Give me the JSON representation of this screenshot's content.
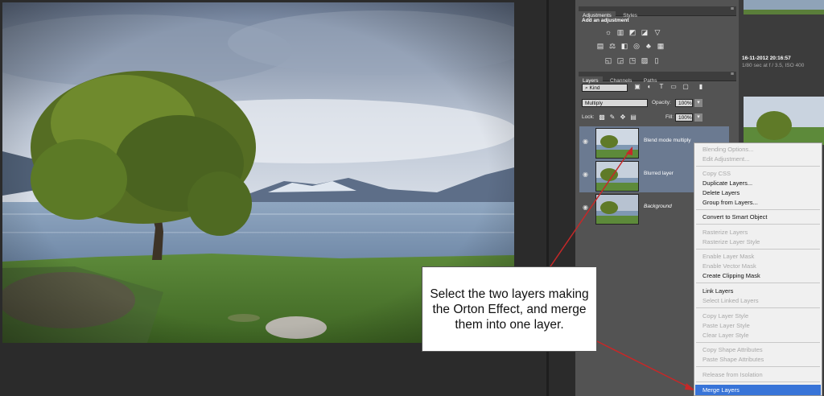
{
  "adjustments": {
    "tabs": [
      "Adjustments",
      "Styles"
    ],
    "heading": "Add an adjustment"
  },
  "layers_panel": {
    "tabs": [
      "Layers",
      "Channels",
      "Paths"
    ],
    "filter_kind": "Kind",
    "blend_mode": "Multiply",
    "opacity_label": "Opacity:",
    "opacity_value": "100%",
    "lock_label": "Lock:",
    "fill_label": "Fill:",
    "fill_value": "100%",
    "layers": [
      {
        "name": "Blend mode multiply"
      },
      {
        "name": "Blurred layer"
      },
      {
        "name": "Background"
      }
    ]
  },
  "history": {
    "timestamp": "16-11-2012 20:16:57",
    "exposure": "1/80 sec at f / 3.5, ISO 400"
  },
  "context_menu": {
    "items": [
      {
        "label": "Blending Options...",
        "enabled": false
      },
      {
        "label": "Edit Adjustment...",
        "enabled": false
      },
      {
        "label": "Copy CSS",
        "enabled": false
      },
      {
        "label": "Duplicate Layers...",
        "enabled": true
      },
      {
        "label": "Delete Layers",
        "enabled": true
      },
      {
        "label": "Group from Layers...",
        "enabled": true
      },
      {
        "label": "Convert to Smart Object",
        "enabled": true
      },
      {
        "label": "Rasterize Layers",
        "enabled": false
      },
      {
        "label": "Rasterize Layer Style",
        "enabled": false
      },
      {
        "label": "Enable Layer Mask",
        "enabled": false
      },
      {
        "label": "Enable Vector Mask",
        "enabled": false
      },
      {
        "label": "Create Clipping Mask",
        "enabled": true
      },
      {
        "label": "Link Layers",
        "enabled": true
      },
      {
        "label": "Select Linked Layers",
        "enabled": false
      },
      {
        "label": "Copy Layer Style",
        "enabled": false
      },
      {
        "label": "Paste Layer Style",
        "enabled": false
      },
      {
        "label": "Clear Layer Style",
        "enabled": false
      },
      {
        "label": "Copy Shape Attributes",
        "enabled": false
      },
      {
        "label": "Paste Shape Attributes",
        "enabled": false
      },
      {
        "label": "Release from Isolation",
        "enabled": false
      },
      {
        "label": "Merge Layers",
        "enabled": true,
        "highlighted": true
      }
    ]
  },
  "callout": {
    "text": "Select the two layers making the Orton Effect, and merge them into one layer."
  },
  "colors": {
    "menu_highlight": "#3874d8",
    "arrow": "#c62828",
    "panel_bg": "#535353"
  }
}
